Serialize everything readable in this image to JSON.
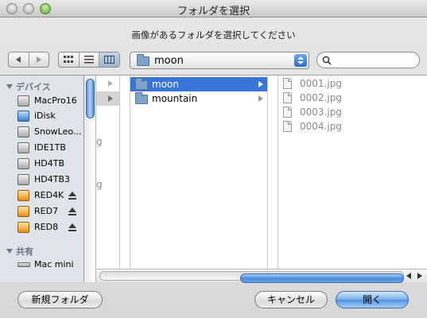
{
  "window": {
    "title": "フォルダを選択"
  },
  "prompt": "画像があるフォルダを選択してください",
  "toolbar": {
    "location": "moon",
    "search_placeholder": ""
  },
  "sidebar": {
    "devices_header": "デバイス",
    "devices": [
      {
        "label": "MacPro16",
        "icon": "internal-disk-icon",
        "eject": false
      },
      {
        "label": "iDisk",
        "icon": "idisk-icon",
        "eject": false
      },
      {
        "label": "SnowLeo...",
        "icon": "hard-drive-icon",
        "eject": false
      },
      {
        "label": "IDE1TB",
        "icon": "hard-drive-icon",
        "eject": false
      },
      {
        "label": "HD4TB",
        "icon": "hard-drive-icon",
        "eject": false
      },
      {
        "label": "HD4TB3",
        "icon": "hard-drive-icon",
        "eject": false
      },
      {
        "label": "RED4K",
        "icon": "external-drive-icon",
        "eject": true
      },
      {
        "label": "RED7",
        "icon": "external-drive-icon",
        "eject": true
      },
      {
        "label": "RED8",
        "icon": "external-drive-icon",
        "eject": true
      }
    ],
    "shared_header": "共有",
    "shared": [
      {
        "label": "Mac mini",
        "icon": "mac-mini-icon"
      }
    ]
  },
  "columns": {
    "partial_col": {
      "fragments": [
        "g",
        "g"
      ]
    },
    "folders": [
      {
        "label": "moon",
        "selected": true
      },
      {
        "label": "mountain",
        "selected": false
      }
    ],
    "files": [
      "0001.jpg",
      "0002.jpg",
      "0003.jpg",
      "0004.jpg"
    ]
  },
  "buttons": {
    "new_folder": "新規フォルダ",
    "cancel": "キャンセル",
    "open": "開く"
  },
  "colors": {
    "selection": "#3875d7",
    "sidebar_bg": "#dfe4ea"
  }
}
